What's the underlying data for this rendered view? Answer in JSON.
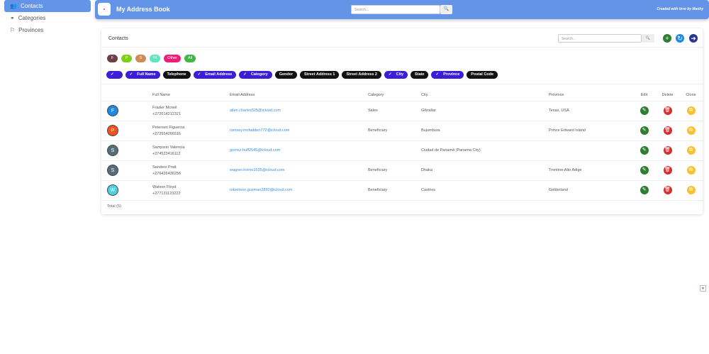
{
  "sidebar": {
    "items": [
      {
        "label": "Contacts",
        "icon": "users-icon",
        "active": true
      },
      {
        "label": "Categories",
        "icon": "shapes-icon"
      },
      {
        "label": "Provinces",
        "icon": "flag-icon"
      }
    ]
  },
  "header": {
    "title": "My Address Book",
    "search_placeholder": "Search...",
    "credit": "Created with love by Mashy"
  },
  "card": {
    "title": "Contacts",
    "search_placeholder": "Search..."
  },
  "letters": [
    {
      "label": "F",
      "color": "#6b3f45"
    },
    {
      "label": "P",
      "color": "#7ccf1a"
    },
    {
      "label": "S",
      "color": "#d08a5a"
    },
    {
      "label": "W",
      "color": "#5de8c0"
    },
    {
      "label": "Other",
      "color": "#ef1d7a"
    },
    {
      "label": "All",
      "color": "#44b548"
    }
  ],
  "columns": [
    {
      "label": "",
      "on": true
    },
    {
      "label": "Full Name",
      "on": true
    },
    {
      "label": "Telephone",
      "on": false
    },
    {
      "label": "Email Address",
      "on": true
    },
    {
      "label": "Category",
      "on": true
    },
    {
      "label": "Gender",
      "on": false
    },
    {
      "label": "Street Address 1",
      "on": false
    },
    {
      "label": "Street Address 2",
      "on": false
    },
    {
      "label": "City",
      "on": true
    },
    {
      "label": "State",
      "on": false
    },
    {
      "label": "Province",
      "on": true
    },
    {
      "label": "Postal Code",
      "on": false
    }
  ],
  "table": {
    "headers": [
      "",
      "Full Name",
      "Email Address",
      "Category",
      "City",
      "Province",
      "Edit",
      "Delete",
      "Clone"
    ],
    "rows": [
      {
        "initial": "F",
        "color": "#1e88e5",
        "name": "Frazier Mcneil",
        "phone": "+272614212321",
        "email": "allen.charles525@icloud.com",
        "category": "Sales",
        "city": "Gibraltar",
        "province": "Texas, USA"
      },
      {
        "initial": "P",
        "color": "#f4511e",
        "name": "Petersen Figueroa",
        "phone": "+272554266516",
        "email": "ramsey.mcfadden772@icloud.com",
        "category": "Beneficiary",
        "city": "Bujumbura",
        "province": "Prince Edward Island"
      },
      {
        "initial": "S",
        "color": "#546e7a",
        "name": "Sampson Valencia",
        "phone": "+274523416112",
        "email": "gomez.huff2545@icloud.com",
        "category": "",
        "city": "Ciudad de Panamá (Panama City)",
        "province": ""
      },
      {
        "initial": "S",
        "color": "#546e7a",
        "name": "Sanders Pratt",
        "phone": "+276426436256",
        "email": "wagner.horne1635@icloud.com",
        "category": "Beneficiary",
        "city": "Dhaka",
        "province": "Trentino-Alto Adige"
      },
      {
        "initial": "W",
        "color": "#4dd0e1",
        "name": "Watson Floyd",
        "phone": "+277131123222",
        "email": "robertson.guzman2850@icloud.com",
        "category": "Beneficiary",
        "city": "Castries",
        "province": "Gelderland"
      }
    ]
  },
  "total": "Total (5)"
}
